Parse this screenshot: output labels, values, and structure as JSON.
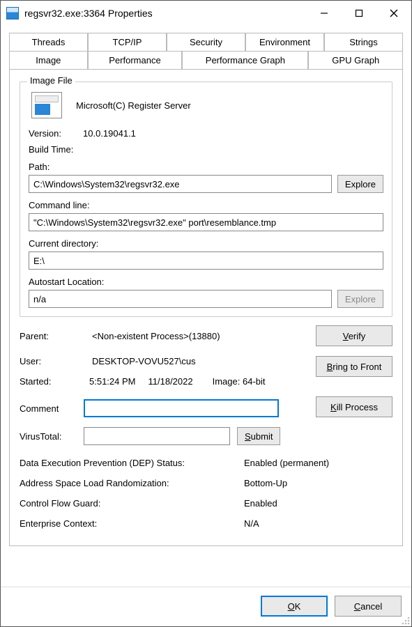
{
  "window": {
    "title": "regsvr32.exe:3364 Properties"
  },
  "tabs_row1": [
    "Threads",
    "TCP/IP",
    "Security",
    "Environment",
    "Strings"
  ],
  "tabs_row2": [
    "Image",
    "Performance",
    "Performance Graph",
    "GPU Graph"
  ],
  "active_tab": "Image",
  "image_file": {
    "legend": "Image File",
    "description": "Microsoft(C) Register Server",
    "version_label": "Version:",
    "version_value": "10.0.19041.1",
    "build_time_label": "Build Time:",
    "build_time_value": "",
    "path_label": "Path:",
    "path_value": "C:\\Windows\\System32\\regsvr32.exe",
    "explore1_label": "Explore",
    "cmd_label": "Command line:",
    "cmd_value": "\"C:\\Windows\\System32\\regsvr32.exe\" port\\resemblance.tmp",
    "cwd_label": "Current directory:",
    "cwd_value": "E:\\",
    "autostart_label": "Autostart Location:",
    "autostart_value": "n/a",
    "explore2_label": "Explore"
  },
  "details": {
    "parent_label": "Parent:",
    "parent_value": "<Non-existent Process>(13880)",
    "user_label": "User:",
    "user_value": "DESKTOP-VOVU527\\cus",
    "started_label": "Started:",
    "started_time": "5:51:24 PM",
    "started_date": "11/18/2022",
    "image_bits_label": "Image:",
    "image_bits_value": "64-bit",
    "verify_btn": "Verify",
    "btf_btn": "Bring to Front",
    "kill_btn": "Kill Process",
    "comment_label": "Comment",
    "comment_value": "",
    "vt_label": "VirusTotal:",
    "vt_value": "",
    "submit_btn": "Submit"
  },
  "security": {
    "dep_label": "Data Execution Prevention (DEP) Status:",
    "dep_value": "Enabled (permanent)",
    "aslr_label": "Address Space Load Randomization:",
    "aslr_value": "Bottom-Up",
    "cfg_label": "Control Flow Guard:",
    "cfg_value": "Enabled",
    "ent_label": "Enterprise Context:",
    "ent_value": "N/A"
  },
  "footer": {
    "ok": "OK",
    "cancel": "Cancel"
  }
}
